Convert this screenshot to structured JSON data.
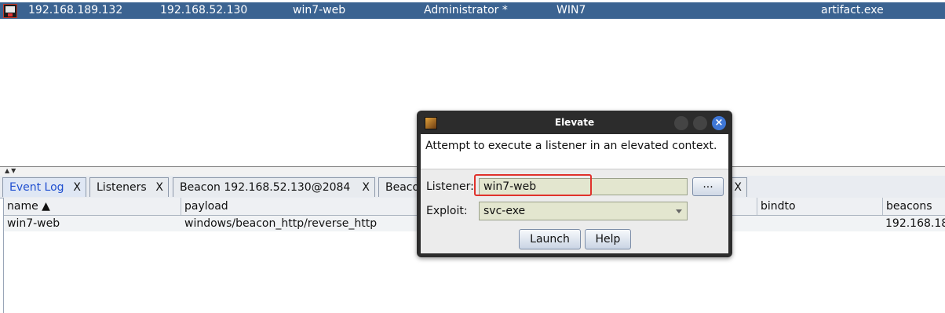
{
  "session": {
    "external_ip": "192.168.189.132",
    "internal_ip": "192.168.52.130",
    "listener": "win7-web",
    "user": "Administrator *",
    "computer": "WIN7",
    "process": "artifact.exe"
  },
  "tabs": [
    {
      "label": "Event Log",
      "close": "X"
    },
    {
      "label": "Listeners",
      "close": "X"
    },
    {
      "label": "Beacon 192.168.52.130@2084",
      "close": "X"
    },
    {
      "label": "Beaco",
      "close": "X"
    }
  ],
  "table": {
    "columns": [
      "name ▲",
      "payload",
      "bindto",
      "beacons"
    ],
    "rows": [
      {
        "name": "win7-web",
        "payload": "windows/beacon_http/reverse_http",
        "bindto": "",
        "beacons": "192.168.18"
      }
    ]
  },
  "dialog": {
    "title": "Elevate",
    "description": "Attempt to execute a listener in an elevated context.",
    "listener_label": "Listener:",
    "listener_value": "win7-web",
    "browse_label": "...",
    "exploit_label": "Exploit:",
    "exploit_value": "svc-exe",
    "launch_label": "Launch",
    "help_label": "Help",
    "close_glyph": "×"
  },
  "colors": {
    "session_row": "#3b6391",
    "highlight": "#e0322c",
    "active_tab_text": "#1f4fd0"
  }
}
